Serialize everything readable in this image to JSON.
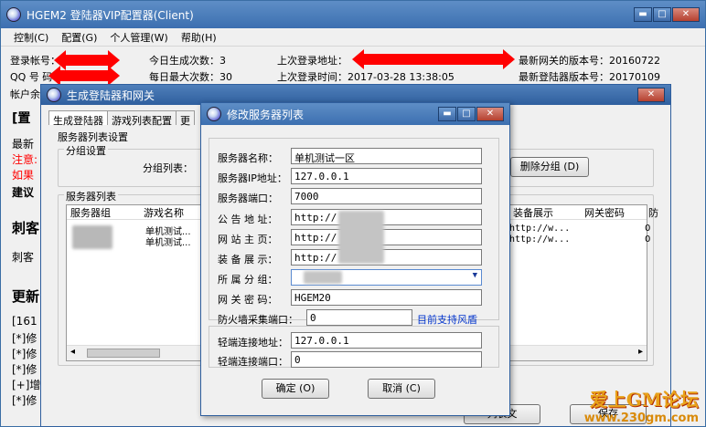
{
  "main": {
    "title": "HGEM2 登陆器VIP配置器(Client)",
    "menu": [
      "控制(C)",
      "配置(G)",
      "个人管理(W)",
      "帮助(H)"
    ],
    "info": {
      "login_account": "登录帐号：",
      "qq": "QQ 号 码：",
      "account_remaining": "帐户余",
      "today_count": "今日生成次数：3",
      "daily_max": "每日最大次数：30",
      "last_login_addr": "上次登录地址：",
      "last_login_time": "上次登录时间：2017-03-28 13:38:05",
      "gateway_version": "最新网关的版本号：20160722",
      "launcher_version": "最新登陆器版本号：20170109"
    },
    "left_texts": [
      "[置",
      "最新",
      "注意:",
      "如果",
      "建议",
      "刺客",
      "刺客",
      "更新",
      "[161",
      "[*]修",
      "[*]修",
      "[*]修",
      "[+]增",
      "[*]修"
    ]
  },
  "win2": {
    "title": "生成登陆器和网关",
    "tabs": [
      "生成登陆器",
      "游戏列表配置",
      "更"
    ],
    "section_label": "服务器列表设置",
    "group_settings": "分组设置",
    "group_list_label": "分组列表：",
    "delete_group": "删除分组 (D)",
    "server_list_label": "服务器列表",
    "columns_left": [
      "服务器组",
      "游戏名称"
    ],
    "columns_right": [
      "装备展示",
      "网关密码",
      "防"
    ],
    "rows": [
      {
        "name": "单机测试...",
        "equip": "http://w...",
        "fw": "0"
      },
      {
        "name": "单机测试...",
        "equip": "http://w...",
        "fw": "0"
      }
    ],
    "bottom_btn1": "列表文",
    "bottom_btn2": "保存"
  },
  "dialog": {
    "title": "修改服务器列表",
    "fields": [
      {
        "label": "服务器名称：",
        "value": "单机测试一区"
      },
      {
        "label": "服务器IP地址：",
        "value": "127.0.0.1"
      },
      {
        "label": "服务器端口：",
        "value": "7000"
      },
      {
        "label": "公 告 地 址：",
        "value": "http://"
      },
      {
        "label": "网 站 主 页：",
        "value": "http://"
      },
      {
        "label": "装 备 展 示：",
        "value": "http://"
      },
      {
        "label": "所 属 分 组：",
        "value": ""
      },
      {
        "label": "网 关 密 码：",
        "value": "HGEM20"
      }
    ],
    "firewall_label": "防火墙采集端口：",
    "firewall_value": "0",
    "firewall_link": "目前支持风盾",
    "client_addr_label": "轻端连接地址：",
    "client_addr_value": "127.0.0.1",
    "client_port_label": "轻端连接端口：",
    "client_port_value": "0",
    "ok": "确定 (O)",
    "cancel": "取消 (C)"
  },
  "watermark": {
    "title": "爱上GM论坛",
    "url": "www.230gm.com"
  },
  "colors": {
    "titlebar": "#3c6fb0",
    "accent_red": "#ff0000",
    "link_blue": "#0033cc",
    "warning_red": "#ff0000"
  }
}
